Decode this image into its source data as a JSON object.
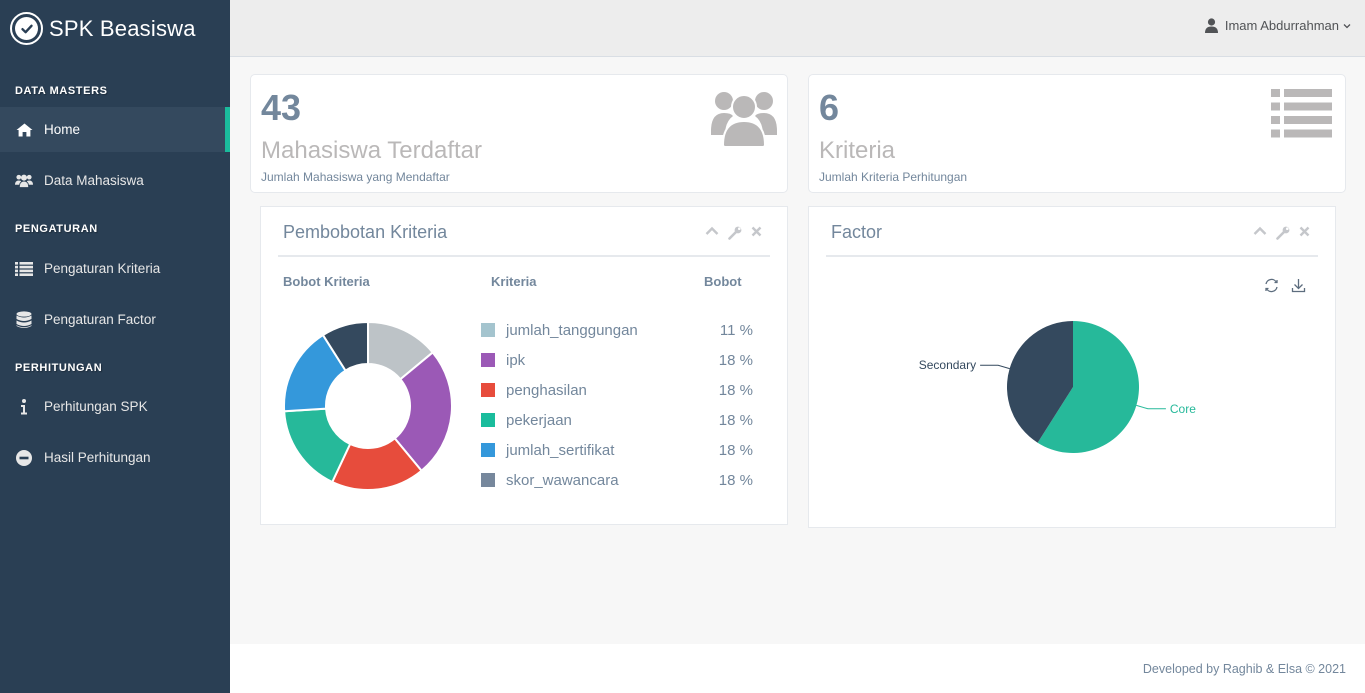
{
  "app": {
    "title": "SPK Beasiswa"
  },
  "sidebar": {
    "sections": [
      {
        "title": "DATA MASTERS"
      },
      {
        "title": "PENGATURAN"
      },
      {
        "title": "PERHITUNGAN"
      }
    ],
    "items": [
      {
        "label": "Home",
        "icon": "home-icon"
      },
      {
        "label": "Data Mahasiswa",
        "icon": "users-icon"
      },
      {
        "label": "Pengaturan Kriteria",
        "icon": "list-icon"
      },
      {
        "label": "Pengaturan Factor",
        "icon": "database-icon"
      },
      {
        "label": "Perhitungan SPK",
        "icon": "info-icon"
      },
      {
        "label": "Hasil Perhitungan",
        "icon": "minus-circle-icon"
      }
    ]
  },
  "header": {
    "user_name": "Imam Abdurrahman"
  },
  "tiles": [
    {
      "count": "43",
      "heading": "Mahasiswa Terdaftar",
      "sub": "Jumlah Mahasiswa yang Mendaftar",
      "icon": "users-icon"
    },
    {
      "count": "6",
      "heading": "Kriteria",
      "sub": "Jumlah Kriteria Perhitungan",
      "icon": "list-icon"
    }
  ],
  "panel_bobot": {
    "title": "Pembobotan Kriteria",
    "col_chart": "Bobot Kriteria",
    "col_kriteria": "Kriteria",
    "col_bobot": "Bobot",
    "rows": [
      {
        "name": "jumlah_tanggungan",
        "bobot": "11 %",
        "color": "#a4c4ce"
      },
      {
        "name": "ipk",
        "bobot": "18 %",
        "color": "#9b59b6"
      },
      {
        "name": "penghasilan",
        "bobot": "18 %",
        "color": "#e74c3c"
      },
      {
        "name": "pekerjaan",
        "bobot": "18 %",
        "color": "#1abc9c"
      },
      {
        "name": "jumlah_sertifikat",
        "bobot": "18 %",
        "color": "#3498db"
      },
      {
        "name": "skor_wawancara",
        "bobot": "18 %",
        "color": "#76879c"
      }
    ]
  },
  "panel_factor": {
    "title": "Factor"
  },
  "chart_data": [
    {
      "type": "pie",
      "title": "Bobot Kriteria",
      "donut": true,
      "slices": [
        {
          "label": "jumlah_tanggungan",
          "value": 14,
          "color": "#bdc3c7"
        },
        {
          "label": "ipk",
          "value": 25,
          "color": "#9b59b6"
        },
        {
          "label": "penghasilan",
          "value": 18,
          "color": "#e74c3c"
        },
        {
          "label": "pekerjaan",
          "value": 17,
          "color": "#26b99a"
        },
        {
          "label": "jumlah_sertifikat",
          "value": 17,
          "color": "#3498db"
        },
        {
          "label": "skor_wawancara",
          "value": 9,
          "color": "#34495e"
        }
      ]
    },
    {
      "type": "pie",
      "title": "Factor",
      "slices": [
        {
          "label": "Core",
          "value": 59,
          "color": "#26b99a"
        },
        {
          "label": "Secondary",
          "value": 41,
          "color": "#34495e"
        }
      ]
    }
  ],
  "footer": {
    "text": "Developed by Raghib & Elsa © 2021"
  },
  "colors": {
    "sidebar": "#2a3f54",
    "accent": "#1abb9c",
    "text": "#73879c"
  }
}
